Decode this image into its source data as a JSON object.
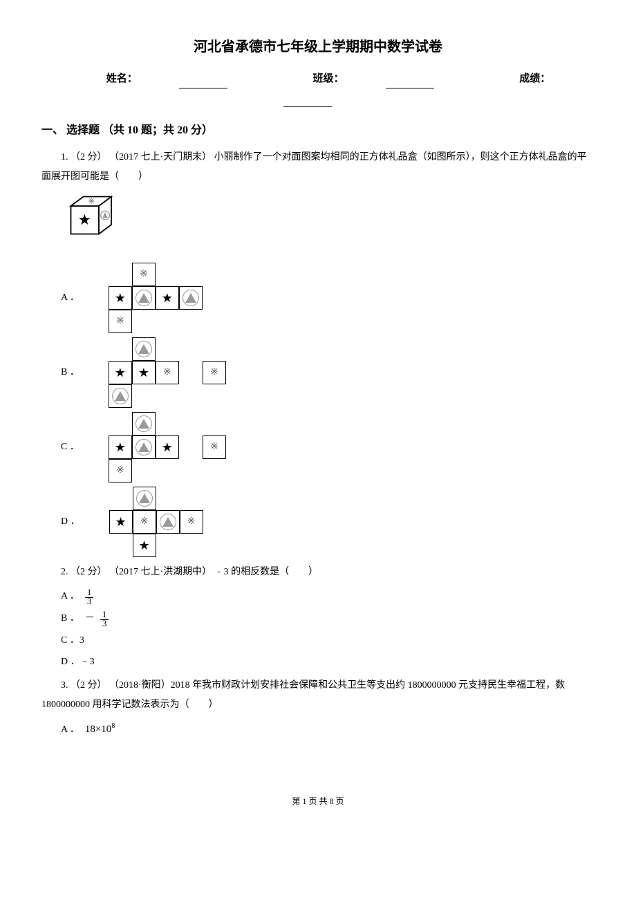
{
  "title": "河北省承德市七年级上学期期中数学试卷",
  "info": {
    "name_label": "姓名：",
    "class_label": "班级：",
    "score_label": "成绩："
  },
  "section1": {
    "header": "一、 选择题 （共 10 题；共 20 分）"
  },
  "q1": {
    "text": "1.  （2 分） （2017 七上·天门期末） 小丽制作了一个对面图案均相同的正方体礼品盒（如图所示），则这个正方体礼品盒的平面展开图可能是（　　）",
    "optA": "A ．",
    "optB": "B ．",
    "optC": "C ．",
    "optD": "D ．"
  },
  "q2": {
    "text": "2.  （2 分） （2017 七上·洪湖期中） ﹣3 的相反数是（　　）",
    "optA": "A ．",
    "optB": "B ．",
    "optC": "C ．3",
    "optD": "D ．﹣3"
  },
  "q3": {
    "text": "3.  （2 分） （2018·衡阳）2018 年我市财政计划安排社会保障和公共卫生等支出约 1800000000 元支持民生幸福工程，数 1800000000 用科学记数法表示为（　　）",
    "optA_prefix": "A ．",
    "optA_formula": "18×10⁸"
  },
  "footer": "第 1 页 共 8 页"
}
